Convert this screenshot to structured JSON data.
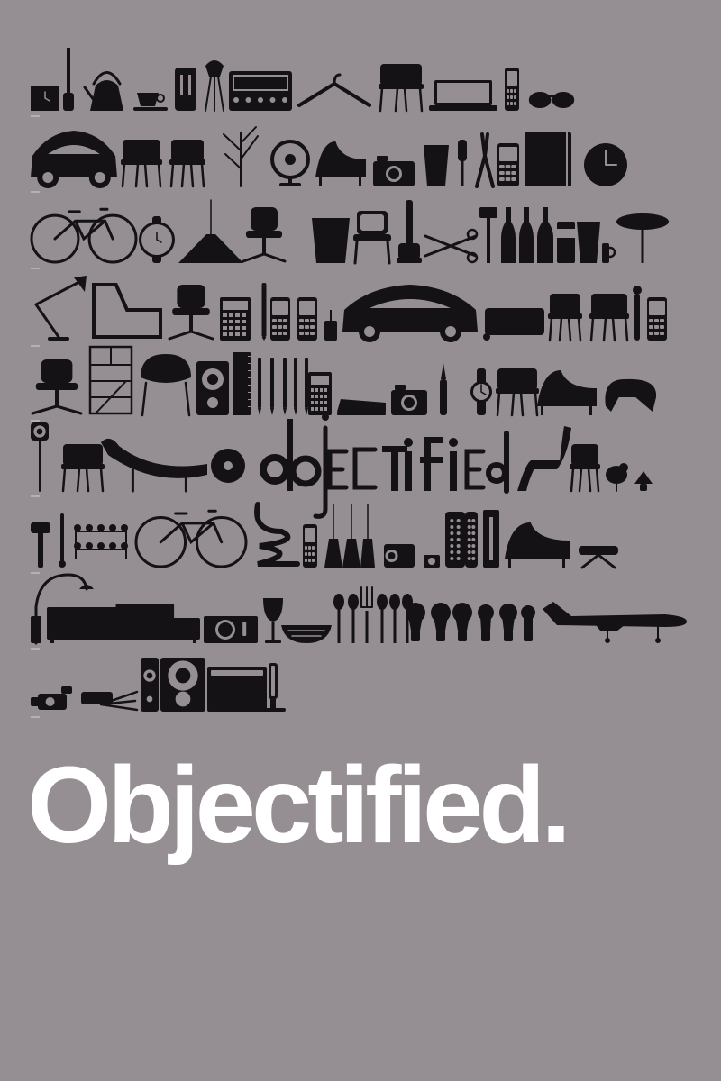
{
  "poster": {
    "title": "Objectified.",
    "background_color": "#958f94",
    "ink_color": "#141214",
    "title_color": "#ffffff"
  },
  "icons": [
    [
      "clock-icon",
      "toothbrush-icon",
      "kettle-icon",
      "cup-and-saucer-icon",
      "toaster-icon",
      "juicer-icon",
      "radio-icon",
      "hanger-icon",
      "chair-icon",
      "laptop-icon",
      "phone-icon",
      "sunglasses-icon"
    ],
    [
      "car-icon",
      "chair-icon",
      "chair-icon",
      "coat-rack-icon",
      "fan-icon",
      "lounge-chair-icon",
      "camera-icon",
      "glass-icon",
      "screwdriver-icon",
      "pliers-icon",
      "phone-icon",
      "notebook-icon",
      "wall-clock-icon"
    ],
    [
      "bicycle-icon",
      "watch-icon",
      "pendant-lamp-icon",
      "office-chair-icon",
      "bin-icon",
      "tv-chair-icon",
      "vacuum-icon",
      "scissors-icon",
      "hammer-icon",
      "bottle-icon",
      "bottle-icon",
      "bottle-icon",
      "can-icon",
      "glass-icon",
      "mug-icon",
      "spoon-icon",
      "computer-icon"
    ],
    [
      "desk-lamp-icon",
      "armchair-icon",
      "office-chair-icon",
      "calculator-icon",
      "pen-icon",
      "phone-icon",
      "phone-icon",
      "usb-stick-icon",
      "car-icon",
      "wheeled-case-icon",
      "chair-icon",
      "chair-icon",
      "pepper-mill-icon",
      "phone-icon"
    ],
    [
      "office-chair-icon",
      "bookshelf-icon",
      "shell-chair-icon",
      "speaker-icon",
      "ruler-icon",
      "pencil-icon",
      "pencil-icon",
      "pencil-icon",
      "pencil-icon",
      "pencil-icon",
      "calculator-icon",
      "stapler-icon",
      "camera-icon",
      "knife-icon",
      "watch-icon",
      "chair-icon",
      "lounge-chair-icon",
      "rocking-elephant-icon"
    ],
    [
      "wall-speaker-icon",
      "chair-icon",
      "chaise-icon",
      "disc-player-icon",
      "o-icon",
      "b-icon",
      "j-icon",
      "e-icon",
      "c-icon",
      "t-icon",
      "i-icon",
      "f-icon",
      "i-icon",
      "e-icon",
      "d-icon",
      "panton-chair-icon",
      "chair-icon",
      "bird-icon",
      "lamp-icon"
    ],
    [
      "peeler-icon",
      "thermometer-icon",
      "hang-it-all-icon",
      "bicycle-icon",
      "wiggle-chair-icon",
      "phone-icon",
      "pendant-lamp-icon",
      "pendant-lamp-icon",
      "pendant-lamp-icon",
      "projector-icon",
      "ipod-icon",
      "remote-icon",
      "remote-icon",
      "router-icon",
      "lounge-chair-icon",
      "ottoman-icon"
    ],
    [
      "arc-lamp-icon",
      "sofa-icon",
      "turntable-icon",
      "wine-glass-icon",
      "bowl-icon",
      "spoon-icon",
      "spoon-icon",
      "fork-icon",
      "spoon-icon",
      "spoon-icon",
      "spoon-icon",
      "light-bulb-icon",
      "light-bulb-icon",
      "light-bulb-icon",
      "light-bulb-icon",
      "light-bulb-icon",
      "light-bulb-icon",
      "airplane-icon"
    ],
    [
      "video-camera-icon",
      "tripod-camera-icon",
      "speaker-icon",
      "speaker-icon",
      "computer-tower-icon",
      "monitor-icon",
      "mouse-icon"
    ]
  ]
}
